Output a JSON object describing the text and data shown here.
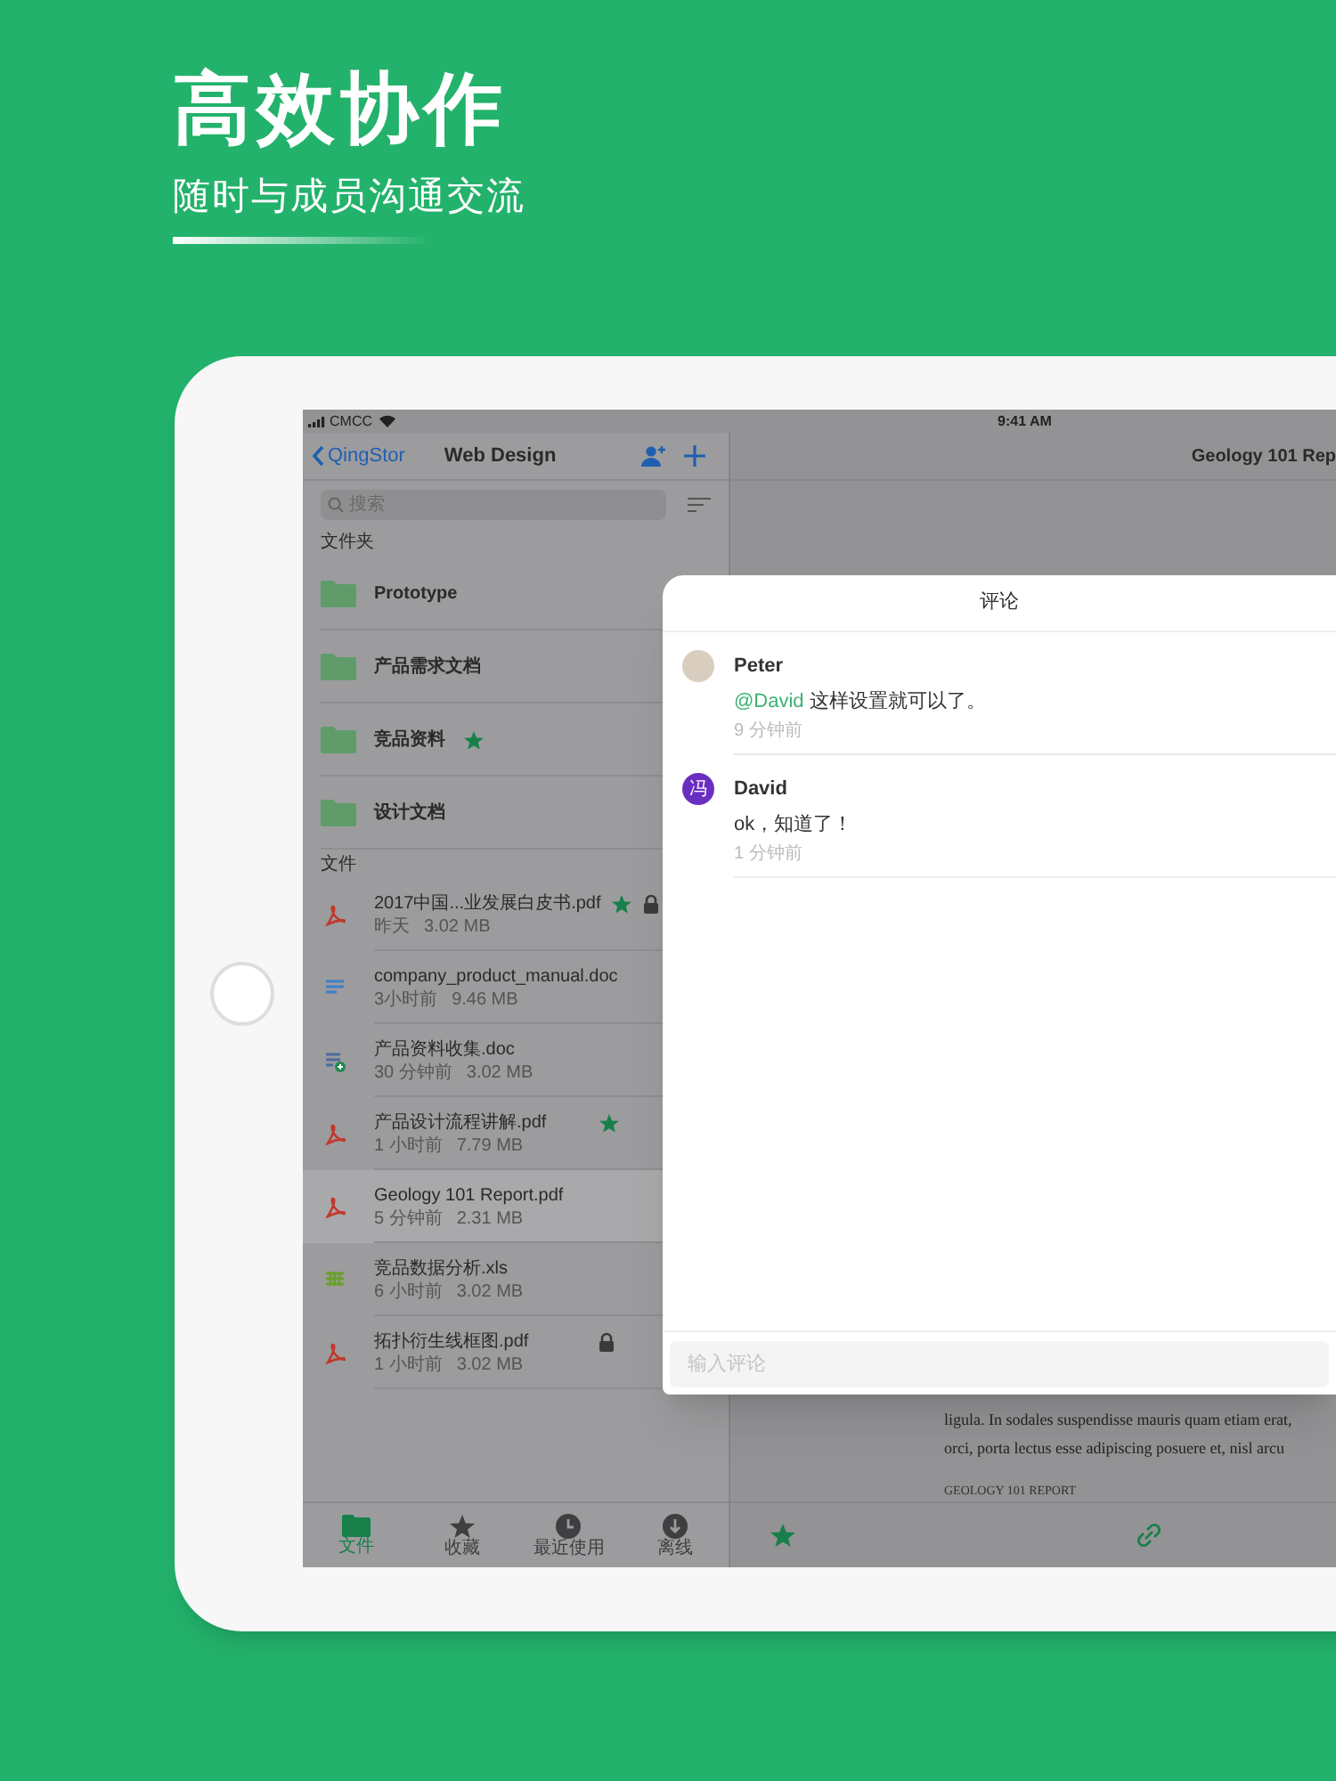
{
  "headline": {
    "title": "高效协作",
    "subtitle": "随时与成员沟通交流"
  },
  "status_bar": {
    "carrier": "CMCC",
    "time": "9:41 AM"
  },
  "sidebar": {
    "back": "QingStor",
    "title": "Web Design",
    "search": {
      "placeholder": "搜索"
    },
    "folders_header": "文件夹",
    "folders": [
      {
        "name": "Prototype",
        "starred": false
      },
      {
        "name": "产品需求文档",
        "starred": false
      },
      {
        "name": "竞品资料",
        "starred": true
      },
      {
        "name": "设计文档",
        "starred": false
      }
    ],
    "files_header": "文件",
    "files": [
      {
        "kind": "pdf",
        "name": "2017中国...业发展白皮书.pdf",
        "time": "昨天",
        "size": "3.02 MB",
        "starred": true,
        "locked": true,
        "selected": false
      },
      {
        "kind": "doc",
        "name": "company_product_manual.doc",
        "time": "3小时前",
        "size": "9.46 MB",
        "starred": false,
        "locked": false,
        "selected": false
      },
      {
        "kind": "doc-shared",
        "name": "产品资料收集.doc",
        "time": "30 分钟前",
        "size": "3.02 MB",
        "starred": false,
        "locked": false,
        "selected": false
      },
      {
        "kind": "pdf",
        "name": "产品设计流程讲解.pdf",
        "time": "1 小时前",
        "size": "7.79 MB",
        "starred": true,
        "locked": false,
        "selected": false
      },
      {
        "kind": "pdf",
        "name": "Geology 101 Report.pdf",
        "time": "5 分钟前",
        "size": "2.31 MB",
        "starred": false,
        "locked": false,
        "selected": true
      },
      {
        "kind": "xls",
        "name": "竞品数据分析.xls",
        "time": "6 小时前",
        "size": "3.02 MB",
        "starred": false,
        "locked": false,
        "selected": false
      },
      {
        "kind": "pdf",
        "name": "拓扑衍生线框图.pdf",
        "time": "1 小时前",
        "size": "3.02 MB",
        "starred": false,
        "locked": true,
        "selected": false
      }
    ],
    "tab_bar": [
      {
        "kind": "files",
        "label": "文件",
        "selected": true
      },
      {
        "kind": "favorites",
        "label": "收藏",
        "selected": false
      },
      {
        "kind": "recent",
        "label": "最近使用",
        "selected": false
      },
      {
        "kind": "offline",
        "label": "离线",
        "selected": false
      }
    ]
  },
  "document": {
    "title": "Geology 101 Rep",
    "lines": [
      "ligula. In sodales suspendisse mauris quam etiam erat,",
      "orci, porta lectus esse adipiscing posuere et, nisl arcu"
    ],
    "heading": "GEOLOGY 101 REPORT"
  },
  "comments": {
    "title": "评论",
    "items": [
      {
        "author": "Peter",
        "kind": "photo",
        "mention": "@David",
        "text": "这样设置就可以了。",
        "time": "9 分钟前"
      },
      {
        "author": "David",
        "kind": "initial",
        "avatar_text": "冯",
        "text": "ok，知道了！",
        "time": "1 分钟前"
      }
    ],
    "input": {
      "placeholder": "输入评论"
    }
  }
}
